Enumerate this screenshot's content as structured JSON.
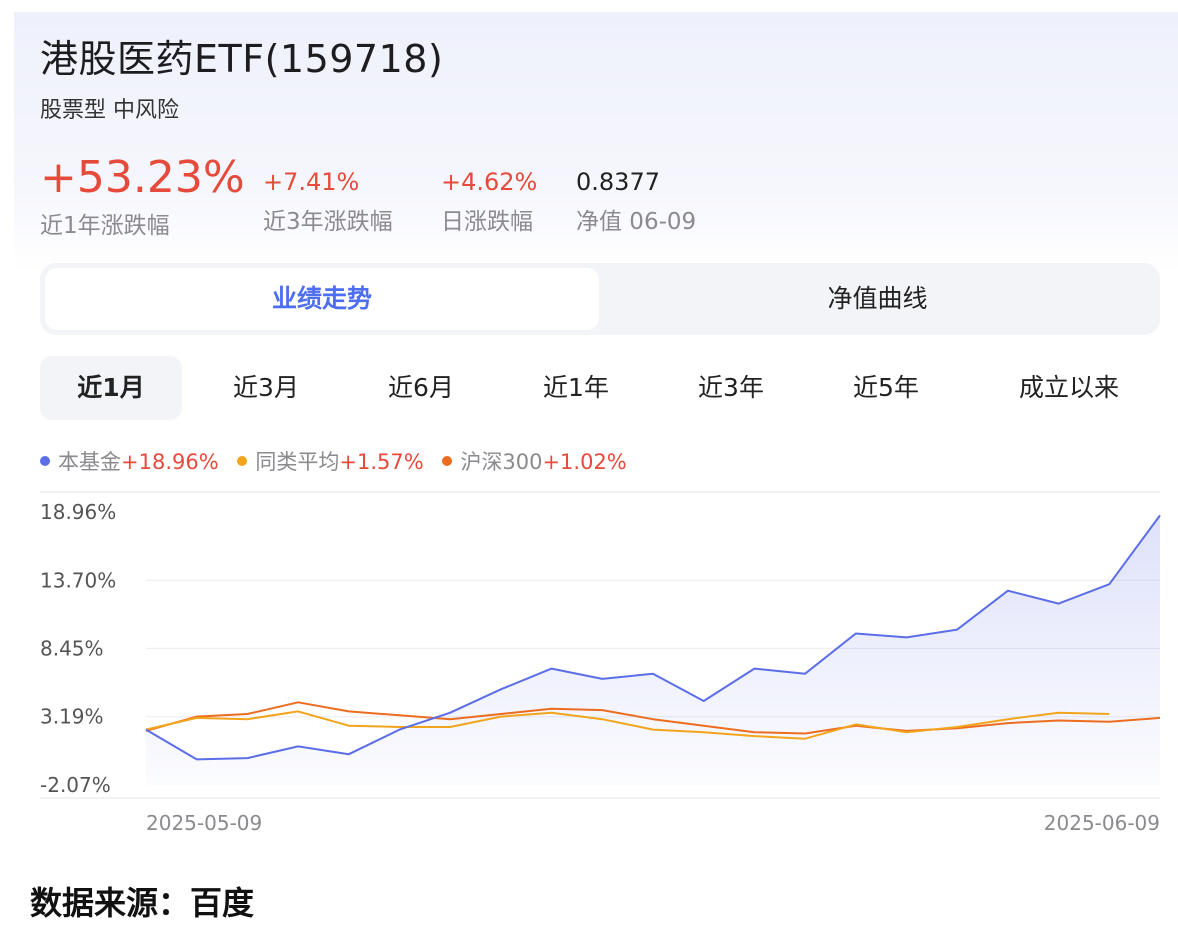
{
  "header": {
    "title": "港股医药ETF(159718)",
    "subtitle": "股票型 中风险"
  },
  "stats": {
    "one_year": {
      "value": "+53.23%",
      "label": "近1年涨跌幅"
    },
    "three_year": {
      "value": "+7.41%",
      "label": "近3年涨跌幅"
    },
    "daily": {
      "value": "+4.62%",
      "label": "日涨跌幅"
    },
    "nav": {
      "value": "0.8377",
      "label": "净值 06-09"
    }
  },
  "tabs": {
    "performance": "业绩走势",
    "nav_curve": "净值曲线"
  },
  "periods": [
    "近1月",
    "近3月",
    "近6月",
    "近1年",
    "近3年",
    "近5年",
    "成立以来"
  ],
  "legend": [
    {
      "name": "本基金",
      "value": "+18.96%",
      "color": "#5b6ee8"
    },
    {
      "name": "同类平均",
      "value": "+1.57%",
      "color": "#f2a41c"
    },
    {
      "name": "沪深300",
      "value": "+1.02%",
      "color": "#ec6d1f"
    }
  ],
  "footer": {
    "source": "数据来源：百度"
  },
  "colors": {
    "accent": "#4e6ef2",
    "up": "#e64a3b",
    "muted": "#8a8a8f"
  },
  "chart_data": {
    "type": "line",
    "title": "",
    "xlabel": "",
    "ylabel": "",
    "x_range": [
      "2025-05-09",
      "2025-06-09"
    ],
    "x_tick_labels": [
      "2025-05-09",
      "2025-06-09"
    ],
    "y_tick_labels": [
      "18.96%",
      "13.70%",
      "8.45%",
      "3.19%",
      "-2.07%"
    ],
    "ylim": [
      -2.07,
      18.96
    ],
    "grid": true,
    "legend_position": "top-left",
    "series": [
      {
        "name": "本基金",
        "color": "#5b6ee8",
        "fill": true,
        "values": [
          2.2,
          -0.1,
          0.0,
          0.9,
          0.3,
          2.2,
          3.5,
          5.3,
          6.9,
          6.1,
          6.5,
          4.4,
          6.9,
          6.5,
          9.6,
          9.3,
          9.9,
          12.9,
          11.9,
          13.4,
          18.7
        ]
      },
      {
        "name": "同类平均",
        "color": "#f2a41c",
        "fill": false,
        "values": [
          2.2,
          3.1,
          3.0,
          3.6,
          2.5,
          2.4,
          2.4,
          3.2,
          3.5,
          3.0,
          2.2,
          2.0,
          1.7,
          1.5,
          2.6,
          2.0,
          2.4,
          3.0,
          3.5,
          3.4
        ]
      },
      {
        "name": "沪深300",
        "color": "#ec6d1f",
        "fill": false,
        "values": [
          2.1,
          3.2,
          3.4,
          4.3,
          3.6,
          3.3,
          3.0,
          3.4,
          3.8,
          3.7,
          3.0,
          2.5,
          2.0,
          1.9,
          2.5,
          2.1,
          2.3,
          2.7,
          2.9,
          2.8,
          3.1
        ]
      }
    ]
  }
}
